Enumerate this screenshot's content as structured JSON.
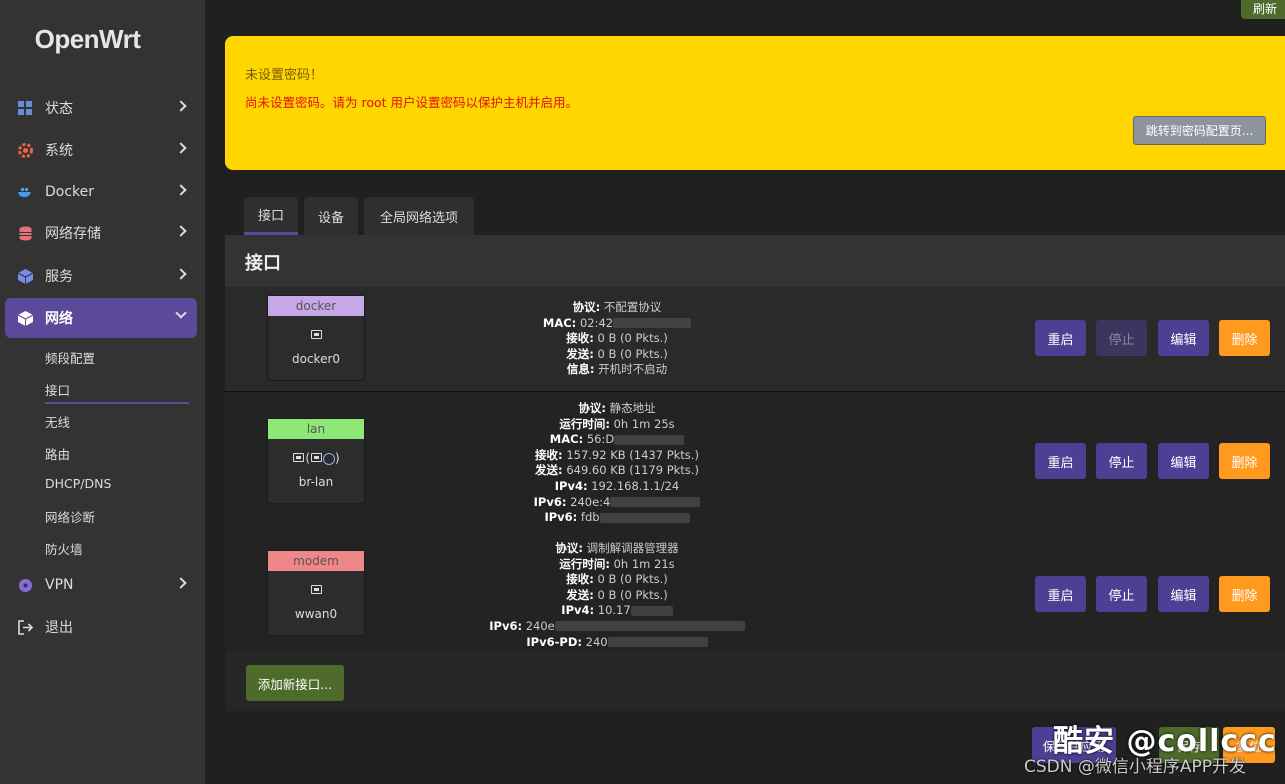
{
  "app": {
    "logo": "OpenWrt"
  },
  "sidebar": {
    "items": [
      {
        "label": "状态",
        "icon": "dashboard-icon"
      },
      {
        "label": "系统",
        "icon": "gear-icon"
      },
      {
        "label": "Docker",
        "icon": "docker-icon"
      },
      {
        "label": "网络存储",
        "icon": "storage-icon"
      },
      {
        "label": "服务",
        "icon": "services-icon"
      },
      {
        "label": "网络",
        "icon": "network-icon"
      },
      {
        "label": "VPN",
        "icon": "vpn-icon"
      },
      {
        "label": "退出",
        "icon": "logout-icon"
      }
    ],
    "sub_items": [
      "频段配置",
      "接口",
      "无线",
      "路由",
      "DHCP/DNS",
      "网络诊断",
      "防火墙"
    ]
  },
  "header": {
    "refresh_label": "刷新"
  },
  "alert": {
    "title": "未设置密码！",
    "message": "尚未设置密码。请为 root 用户设置密码以保护主机并启用。",
    "button": "跳转到密码配置页..."
  },
  "tabs": [
    "接口",
    "设备",
    "全局网络选项"
  ],
  "panel": {
    "title": "接口"
  },
  "interfaces": [
    {
      "name": "docker",
      "device": "docker0",
      "color": "#c6a8e8",
      "info": [
        {
          "k": "协议:",
          "v": "不配置协议"
        },
        {
          "k": "MAC:",
          "v": "02:42"
        },
        {
          "k": "接收:",
          "v": "0 B (0 Pkts.)"
        },
        {
          "k": "发送:",
          "v": "0 B (0 Pkts.)"
        },
        {
          "k": "信息:",
          "v": "开机时不启动"
        }
      ]
    },
    {
      "name": "lan",
      "device": "br-lan",
      "color": "#8ee878",
      "info": [
        {
          "k": "协议:",
          "v": "静态地址"
        },
        {
          "k": "运行时间:",
          "v": "0h 1m 25s"
        },
        {
          "k": "MAC:",
          "v": "56:D"
        },
        {
          "k": "接收:",
          "v": "157.92 KB (1437 Pkts.)"
        },
        {
          "k": "发送:",
          "v": "649.60 KB (1179 Pkts.)"
        },
        {
          "k": "IPv4:",
          "v": "192.168.1.1/24"
        },
        {
          "k": "IPv6:",
          "v": "240e:4"
        },
        {
          "k": "IPv6:",
          "v": "fdb"
        }
      ]
    },
    {
      "name": "modem",
      "device": "wwan0",
      "color": "#f0888a",
      "info": [
        {
          "k": "协议:",
          "v": "调制解调器管理器"
        },
        {
          "k": "运行时间:",
          "v": "0h 1m 21s"
        },
        {
          "k": "接收:",
          "v": "0 B (0 Pkts.)"
        },
        {
          "k": "发送:",
          "v": "0 B (0 Pkts.)"
        },
        {
          "k": "IPv4:",
          "v": "10.17"
        },
        {
          "k": "IPv6:",
          "v": "240e"
        },
        {
          "k": "IPv6-PD:",
          "v": "240"
        }
      ]
    }
  ],
  "row_buttons": {
    "restart": "重启",
    "stop": "停止",
    "edit": "编辑",
    "delete": "删除"
  },
  "add_button": "添加新接口...",
  "footer": {
    "save_apply": "保存并应用",
    "save": "保存",
    "reset": "复位"
  },
  "watermark": {
    "line1": "酷安 @collccc",
    "line2": "CSDN @微信小程序APP开发"
  }
}
